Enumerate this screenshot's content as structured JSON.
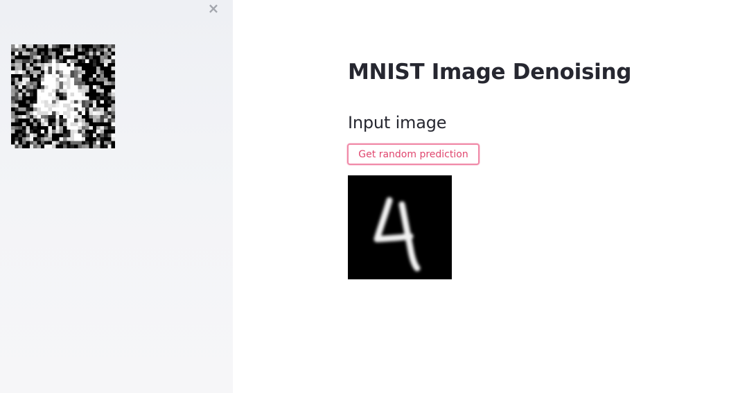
{
  "sidebar": {
    "close_label": "×",
    "close_icon": "close-icon",
    "noisy_image": {
      "digit": "4",
      "background": "#000000",
      "foreground": "#ffffff"
    }
  },
  "main": {
    "title": "MNIST Image Denoising",
    "subtitle": "Input image",
    "button_label": "Get random prediction",
    "clean_image": {
      "digit": "4",
      "background": "#000000",
      "foreground": "#ffffff"
    }
  },
  "colors": {
    "sidebar_bg": "#f0f2f6",
    "text": "#262730",
    "button_border": "#f08aa8",
    "button_text": "#e0466e",
    "close_icon": "#a3a6ad"
  }
}
